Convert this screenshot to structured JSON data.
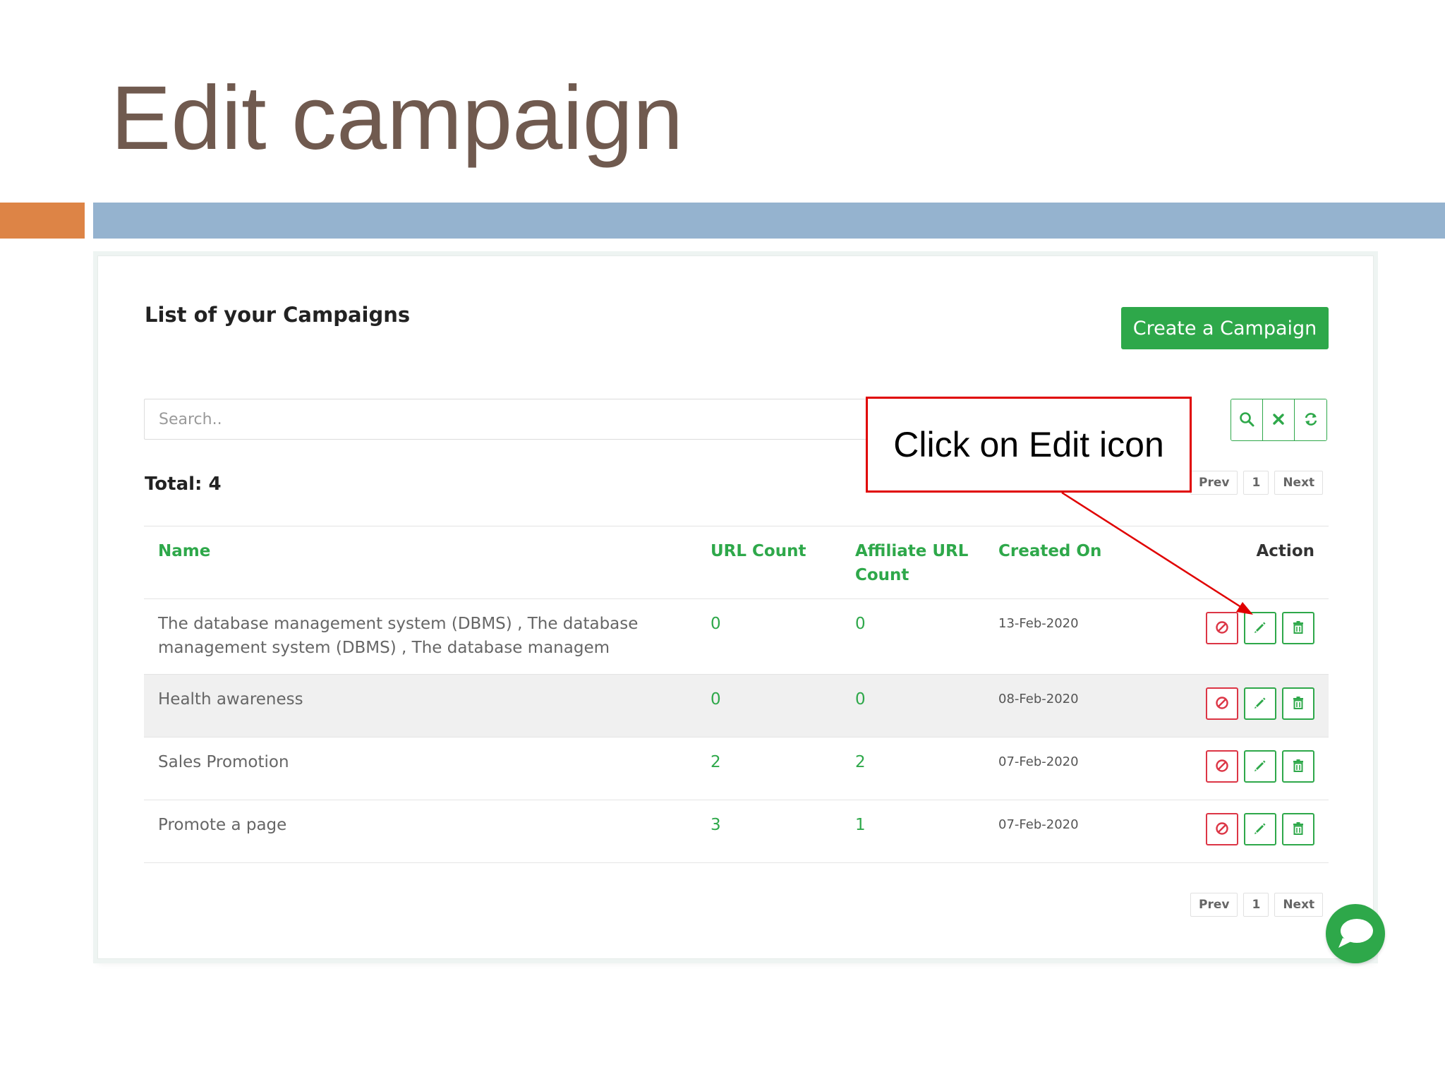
{
  "slide": {
    "title": "Edit campaign"
  },
  "panel": {
    "heading": "List of your Campaigns",
    "create_button_label": "Create a Campaign",
    "search": {
      "placeholder": "Search..",
      "value": ""
    },
    "total_label": "Total: 4",
    "pager": {
      "prev_label": "Prev",
      "page_label": "1",
      "next_label": "Next"
    },
    "table": {
      "headers": {
        "name": "Name",
        "url_count": "URL Count",
        "affiliate_url_count": "Affiliate URL Count",
        "created_on": "Created On",
        "action": "Action"
      },
      "rows": [
        {
          "name": "The database management system (DBMS) , The database management system (DBMS) , The database managem",
          "url_count": "0",
          "affiliate_url_count": "0",
          "created_on": "13-Feb-2020"
        },
        {
          "name": "Health awareness",
          "url_count": "0",
          "affiliate_url_count": "0",
          "created_on": "08-Feb-2020"
        },
        {
          "name": "Sales Promotion",
          "url_count": "2",
          "affiliate_url_count": "2",
          "created_on": "07-Feb-2020"
        },
        {
          "name": "Promote a page",
          "url_count": "3",
          "affiliate_url_count": "1",
          "created_on": "07-Feb-2020"
        }
      ]
    }
  },
  "callout": {
    "text": "Click on Edit icon"
  },
  "icons": {
    "search": "search-icon",
    "clear": "close-icon",
    "refresh": "refresh-icon",
    "disable": "ban-icon",
    "edit": "pencil-icon",
    "delete": "trash-icon",
    "chat": "chat-icon"
  },
  "colors": {
    "title": "#705a4f",
    "accent_orange": "#dd8446",
    "accent_blue": "#95b3cf",
    "primary_green": "#2ea84a",
    "danger_red": "#dc3545",
    "callout_red": "#e00000"
  }
}
